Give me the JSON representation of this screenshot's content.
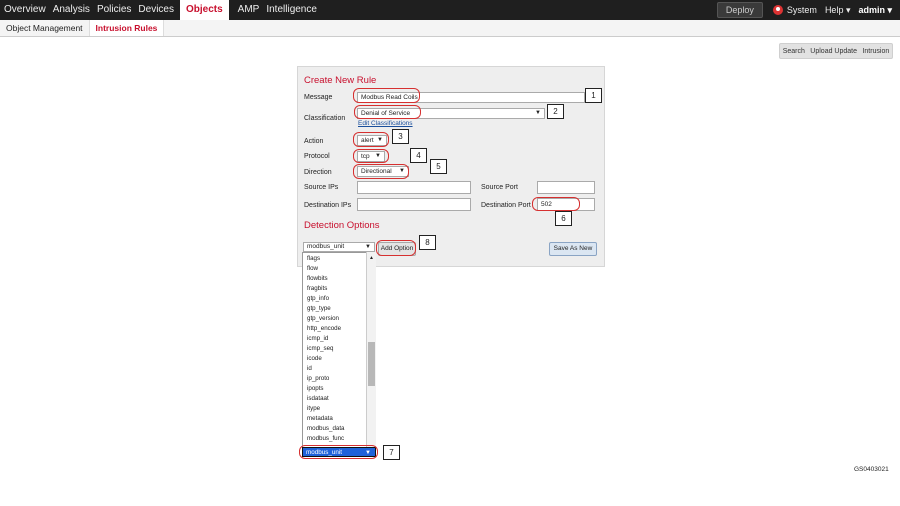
{
  "topnav": {
    "items": [
      "Overview",
      "Analysis",
      "Policies",
      "Devices",
      "Objects",
      "AMP",
      "Intelligence"
    ],
    "deploy": "Deploy",
    "system": "System",
    "help": "Help ▾",
    "admin": "admin ▾"
  },
  "subnav": {
    "items": [
      "Object Management",
      "Intrusion Rules"
    ]
  },
  "toolbar": {
    "search": "Search",
    "upload": "Upload Update",
    "intrusion": "Intrusion"
  },
  "form": {
    "title": "Create New Rule",
    "message_label": "Message",
    "message_value": "Modbus Read Coils",
    "classification_label": "Classification",
    "classification_value": "Denial of Service",
    "edit_classifications": "Edit Classifications",
    "action_label": "Action",
    "action_value": "alert",
    "protocol_label": "Protocol",
    "protocol_value": "tcp",
    "direction_label": "Direction",
    "direction_value": "Directional",
    "source_ips_label": "Source IPs",
    "source_port_label": "Source Port",
    "dest_ips_label": "Destination IPs",
    "dest_port_label": "Destination Port",
    "dest_port_value": "502",
    "detection_title": "Detection Options",
    "option_select_value": "modbus_unit",
    "add_option": "Add Option",
    "save_as_new": "Save As New"
  },
  "dropdown": {
    "items": [
      "flags",
      "flow",
      "flowbits",
      "fragbits",
      "gtp_info",
      "gtp_type",
      "gtp_version",
      "http_encode",
      "icmp_id",
      "icmp_seq",
      "icode",
      "id",
      "ip_proto",
      "ipopts",
      "isdataat",
      "itype",
      "metadata",
      "modbus_data",
      "modbus_func"
    ],
    "selected": "modbus_unit"
  },
  "callouts": [
    "1",
    "2",
    "3",
    "4",
    "5",
    "6",
    "7",
    "8"
  ],
  "figure_code": "GS0403021",
  "colors": {
    "accent": "#c8102e",
    "highlight": "#d63030",
    "nav_bg": "#1f1f1f",
    "selection": "#1f62d9"
  }
}
